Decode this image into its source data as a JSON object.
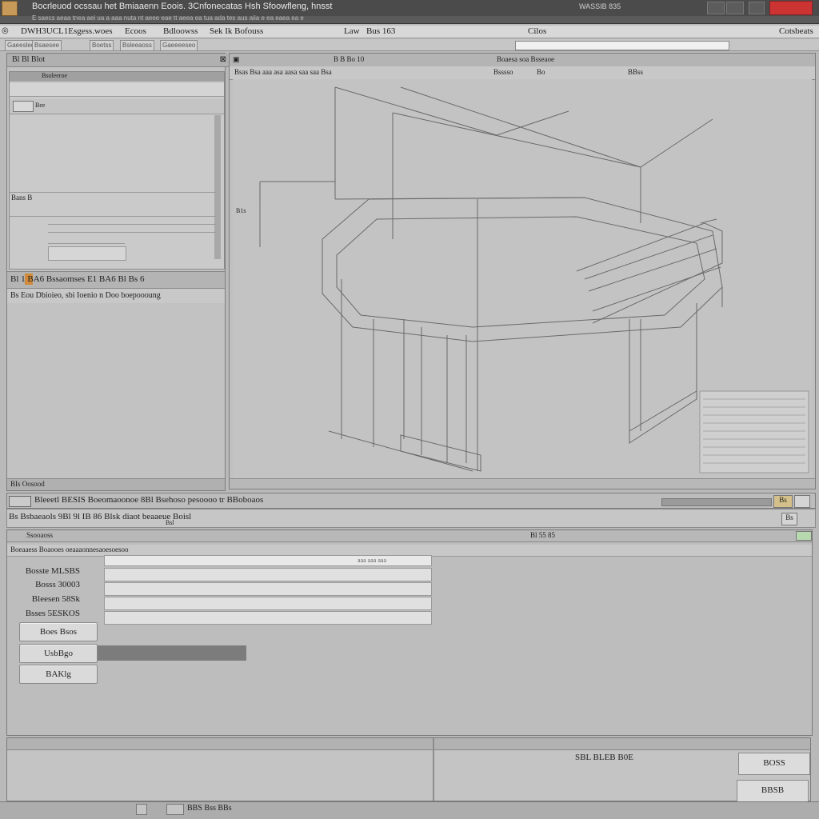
{
  "window": {
    "title": "Bocrleuod ocssau het Bmiaaenn Eoois. 3Cnfonecatas  Hsh Sfoowfleng, hnsst",
    "right_text": "WASSIB 835",
    "subbar_text": "E saecs aeaa tnea aei ua a aaa nuta nt aeee eae tt aeea ea tua ada tes aus aiia e ea eaea ea e"
  },
  "menu": {
    "items": [
      "DWH3UCL1Esgess.woes",
      "Ecoos",
      "Bdloowss",
      "Sek Ik Bofouss",
      "Law",
      "Bus 163",
      "Cilos",
      "Cotsbeats"
    ]
  },
  "toolbar": {
    "buttons": [
      "Gaeesleo",
      "Bsaesee",
      "Boetss",
      "Bsleeaoss",
      "Gaeeeeseo"
    ]
  },
  "left_panel": {
    "title": "Bl Bl Blot",
    "sub_header": "Bsoleeroe",
    "sub_title": "Bee",
    "row_label": "Bans B",
    "toolbar_text": "Bl 1 BA6 Bssaomses E1 BA6 Bl Bs 6",
    "description": "Bs Eou Dbioieo, sbi Ioenio n Doo boepoooung",
    "footer": "BIs Oosood"
  },
  "viewport": {
    "header": "B B Bo 10",
    "header_right": "Boaesa soa Bsseaoe",
    "sub_left": "Bsas Bsa aaa asa aasa saa saa Bsa",
    "sub_mid": "Bsssso",
    "sub_mid2": "Bo",
    "sub_right": "BBss",
    "axis_label": "B1s"
  },
  "status": {
    "line1": "Bleeetl BESIS Boeomaoonoe 8Bl Bsehoso pesoooo tr BBoboaos",
    "line2": "Bs Bsbaeaols 9Bl 9l IB 86 Blsk diaot beaaeue Boisl",
    "line2_sub": "Bsl",
    "btn1": "Bs",
    "btn2": "Bs"
  },
  "form": {
    "header": "Ssooaoss",
    "header_right": "Bl 55 85",
    "subheader": "Boeaaess Boaooes oeaaaonnesaoesoesoo",
    "input_hint": "aaa aaa aaa",
    "fields": [
      {
        "label": "Bosste MLSBS",
        "value": ""
      },
      {
        "label": "Bosss 30003",
        "value": ""
      },
      {
        "label": "Bleesen 58Sk",
        "value": ""
      },
      {
        "label": "Bsses 5ESKOS",
        "value": ""
      }
    ],
    "buttons": [
      "Boes Bsos",
      "UsbBgo",
      "BAKlg"
    ]
  },
  "footer": {
    "text": "SBL BLEB B0E",
    "btn1": "BOSS",
    "btn2": "BBSB"
  },
  "statusbar": {
    "text": "BBS Bss BBs"
  }
}
